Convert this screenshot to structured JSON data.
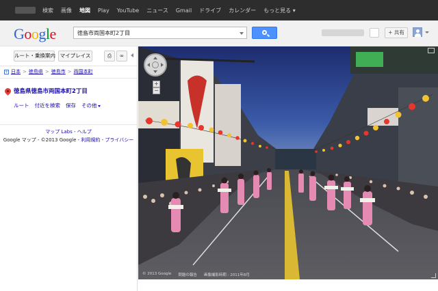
{
  "gbar": {
    "items": [
      "検索",
      "画像",
      "地図",
      "Play",
      "YouTube",
      "ニュース",
      "Gmail",
      "ドライブ",
      "カレンダー",
      "もっと見る ▾"
    ],
    "active_index": 2
  },
  "header": {
    "search_value": "徳島市両国本町2丁目",
    "share_label": "+ 共有"
  },
  "panel": {
    "route_label": "ルート・乗換案内",
    "myplace_label": "マイプレイス",
    "print_icon": "⎙",
    "link_icon": "∞",
    "breadcrumb": [
      "日本",
      "徳島県",
      "徳島市",
      "両国本町"
    ],
    "address": "徳島県徳島市両国本町2丁目",
    "actions": [
      "ルート",
      "付近を検索",
      "保存",
      "その他"
    ],
    "footer_links": "マップ Labs - ヘルプ",
    "footer_copy": "Google マップ - ©2013 Google - ",
    "footer_terms": "利用規約",
    "footer_sep": " - ",
    "footer_privacy": "プライバシー"
  },
  "streetview": {
    "copyright": "© 2013 Google",
    "report": "問題の報告",
    "capture_date": "画像撮影時期 : 2011年8月",
    "zoom_in": "+",
    "zoom_out": "−"
  },
  "colors": {
    "gbar_bg": "#2d2d2d",
    "search_button": "#4d90fe",
    "link": "#1a0dab",
    "lantern": "#e8362c",
    "lantern_yellow": "#f2c230",
    "dancer_pink": "#e58ab2"
  }
}
